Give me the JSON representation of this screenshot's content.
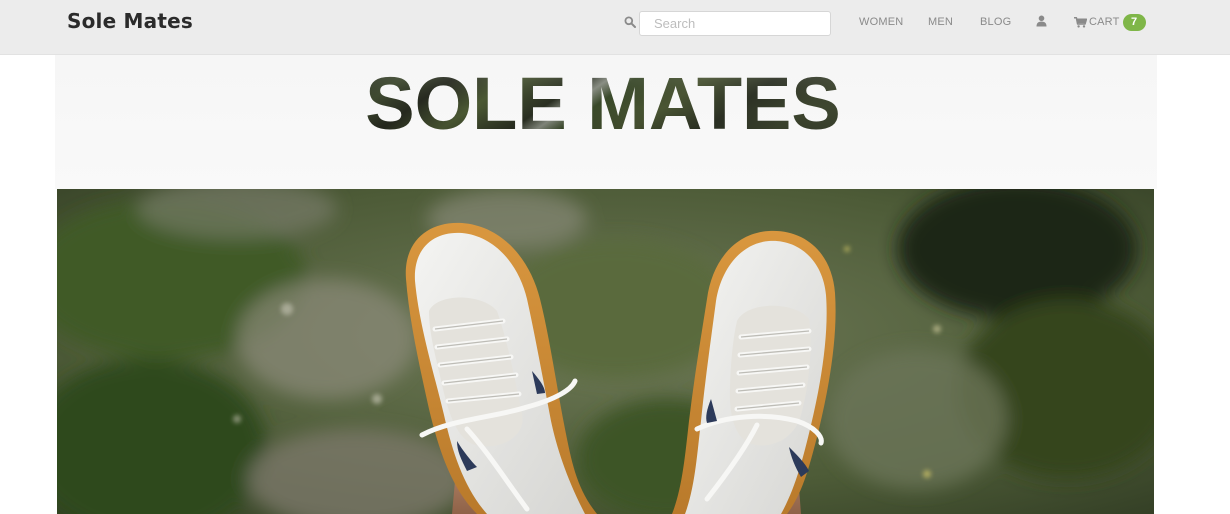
{
  "brand": {
    "name": "Sole Mates"
  },
  "search": {
    "placeholder": "Search",
    "icon": "search-icon"
  },
  "nav": {
    "links": [
      {
        "label": "WOMEN"
      },
      {
        "label": "MEN"
      },
      {
        "label": "BLOG"
      }
    ],
    "user_icon": "user-icon",
    "cart": {
      "label": "CART",
      "count": "7",
      "icon": "cart-icon"
    }
  },
  "hero": {
    "title": "SOLE MATES"
  },
  "colors": {
    "navbar_bg": "#ececec",
    "badge_green": "#7fb648",
    "nav_text": "#8a8a8a",
    "brand_text": "#2b2b2b"
  }
}
